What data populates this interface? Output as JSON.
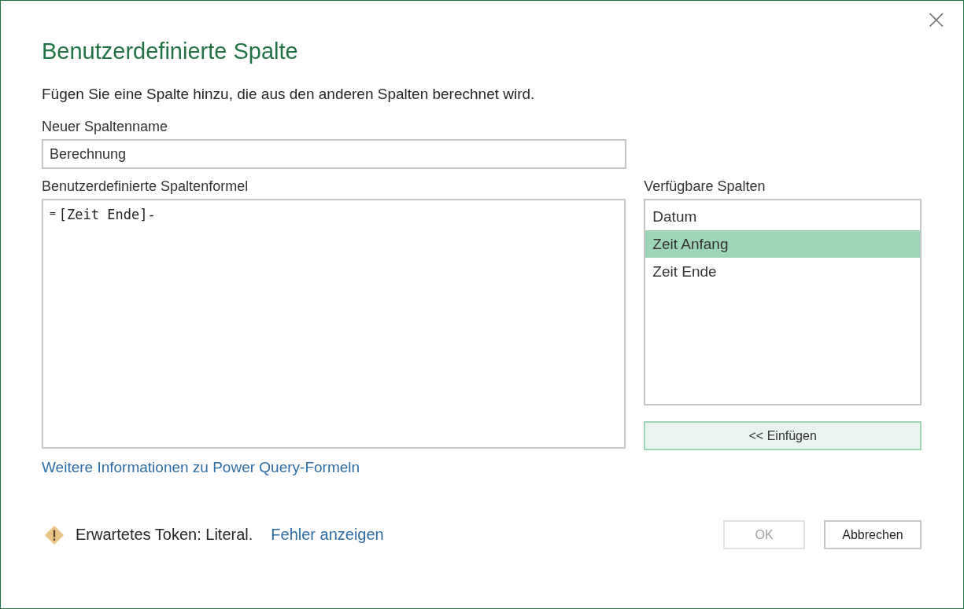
{
  "window": {
    "close": "×"
  },
  "title": "Benutzerdefinierte Spalte",
  "description": "Fügen Sie eine Spalte hinzu, die aus den anderen Spalten berechnet wird.",
  "name_field": {
    "label": "Neuer Spaltenname",
    "value": "Berechnung"
  },
  "formula": {
    "label": "Benutzerdefinierte Spaltenformel",
    "prefix": "=",
    "value": "[Zeit Ende]-"
  },
  "available_columns": {
    "label": "Verfügbare Spalten",
    "items": [
      {
        "name": "Datum",
        "selected": false
      },
      {
        "name": "Zeit Anfang",
        "selected": true
      },
      {
        "name": "Zeit Ende",
        "selected": false
      }
    ],
    "insert_button": "<< Einfügen"
  },
  "help_link": "Weitere Informationen zu Power Query-Formeln",
  "status": {
    "message": "Erwartetes Token: Literal.",
    "link": "Fehler anzeigen"
  },
  "buttons": [
    {
      "label": "OK",
      "disabled": true
    },
    {
      "label": "Abbrechen",
      "disabled": false
    }
  ]
}
